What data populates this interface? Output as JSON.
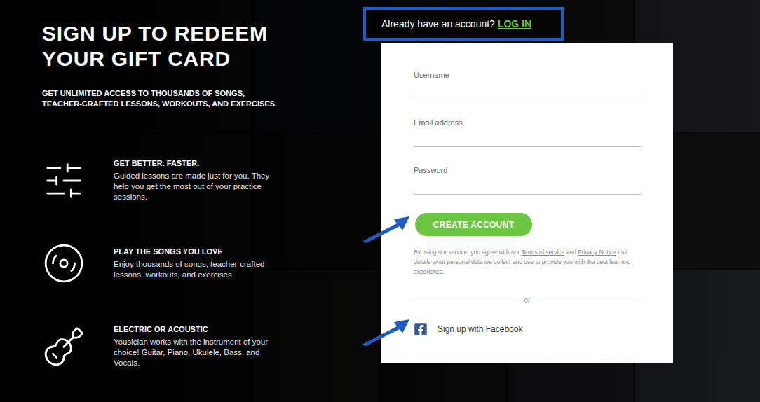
{
  "page": {
    "heading_lines": [
      "SIGN UP TO REDEEM",
      "YOUR GIFT CARD"
    ],
    "subheading": "GET UNLIMITED ACCESS TO THOUSANDS OF SONGS, TEACHER-CRAFTED LESSONS, WORKOUTS, AND EXERCISES."
  },
  "features": [
    {
      "kind": "lessons",
      "title": "GET BETTER. FASTER.",
      "text": "Guided lessons are made just for you. They help you get the most out of your practice sessions."
    },
    {
      "kind": "songs",
      "title": "PLAY THE SONGS YOU LOVE",
      "text": "Enjoy thousands of songs, teacher-crafted lessons, workouts, and exercises."
    },
    {
      "kind": "instruments",
      "title": "ELECTRIC OR ACOUSTIC",
      "text": "Yousician works with the instrument of your choice! Guitar, Piano, Ukulele, Bass, and Vocals."
    }
  ],
  "login": {
    "prompt": "Already have an account?",
    "link": "LOG IN"
  },
  "form": {
    "fields": [
      {
        "label": "Username",
        "value": ""
      },
      {
        "label": "Email address",
        "value": ""
      },
      {
        "label": "Password",
        "value": ""
      }
    ],
    "submit": "CREATE ACCOUNT",
    "terms": {
      "before": "By using our service, you agree with our ",
      "terms_link": "Terms of service",
      "between": " and ",
      "privacy_link": "Privacy Notice",
      "after": " that details what personal data we collect and use to provide you with the best learning experience."
    },
    "divider": "or",
    "facebook": "Sign up with Facebook"
  }
}
